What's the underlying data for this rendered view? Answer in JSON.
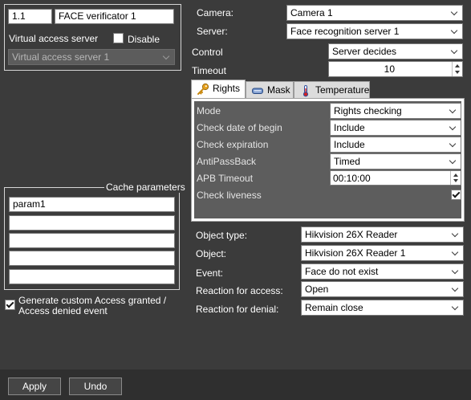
{
  "server_box": {
    "id": "1.1",
    "name": "FACE verificator 1",
    "virtual_access_server_label": "Virtual access server",
    "disable_label": "Disable",
    "disable_checked": false,
    "virtual_access_server_value": "Virtual access server 1"
  },
  "cache": {
    "title": "Cache parameters",
    "params": [
      "param1",
      "",
      "",
      "",
      ""
    ]
  },
  "custom_event": {
    "label_line1": "Generate custom Access granted /",
    "label_line2": "Access denied event",
    "checked": true
  },
  "settings": {
    "camera_label": "Camera:",
    "camera_value": "Camera 1",
    "server_label": "Server:",
    "server_value": "Face recognition server 1",
    "control_label": "Control",
    "control_value": "Server decides",
    "timeout_label": "Timeout",
    "timeout_value": "10"
  },
  "tabs": [
    {
      "label": "Rights",
      "icon": "key-icon",
      "active": true
    },
    {
      "label": "Mask",
      "icon": "mask-icon",
      "active": false
    },
    {
      "label": "Temperature",
      "icon": "thermometer-icon",
      "active": false
    }
  ],
  "rights": {
    "mode_label": "Mode",
    "mode_value": "Rights checking",
    "check_date_label": "Check date of begin",
    "check_date_value": "Include",
    "check_expiration_label": "Check expiration",
    "check_expiration_value": "Include",
    "antipassback_label": "AntiPassBack",
    "antipassback_value": "Timed",
    "apb_timeout_label": "APB Timeout",
    "apb_timeout_value": "00:10:00",
    "check_liveness_label": "Check liveness",
    "check_liveness_checked": true
  },
  "object_section": {
    "object_type_label": "Object type:",
    "object_type_value": "Hikvision 26X Reader",
    "object_label": "Object:",
    "object_value": "Hikvision 26X Reader 1",
    "event_label": "Event:",
    "event_value": "Face do not exist",
    "reaction_access_label": "Reaction for access:",
    "reaction_access_value": "Open",
    "reaction_denial_label": "Reaction for denial:",
    "reaction_denial_value": "Remain close"
  },
  "footer": {
    "apply_label": "Apply",
    "undo_label": "Undo"
  }
}
